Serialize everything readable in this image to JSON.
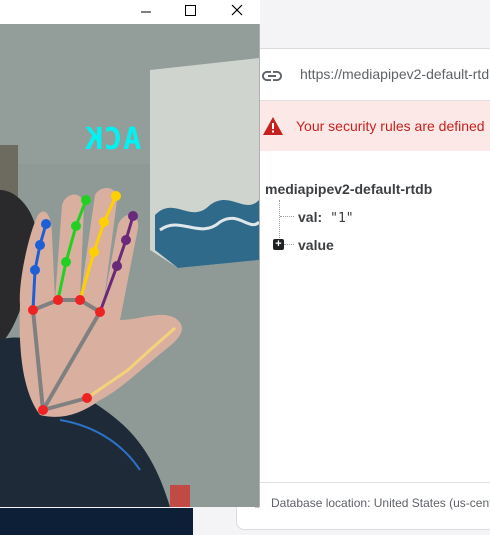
{
  "firebase": {
    "url": "https://mediapipev2-default-rtdb",
    "alert_text": "Your security rules are defined",
    "tree": {
      "root": "mediapipev2-default-rtdb",
      "rows": [
        {
          "key": "val:",
          "value": "\"1\""
        },
        {
          "key": "value"
        }
      ],
      "expand_symbol": "+"
    },
    "footer": "Database location: United States (us-cent"
  },
  "camera_window": {
    "gesture_label": "ACK",
    "controls": {
      "minimize": "minimize",
      "maximize": "maximize",
      "close": "close"
    }
  },
  "colors": {
    "alert_bg": "#fce8e6",
    "alert_text": "#c5221f",
    "label": "#00f3f3",
    "thumb": "#1f5fd6",
    "index": "#22d022",
    "middle": "#ffd000",
    "ring": "#6a2a7a",
    "palm_joint": "#ee2222",
    "bone": "#808080"
  }
}
